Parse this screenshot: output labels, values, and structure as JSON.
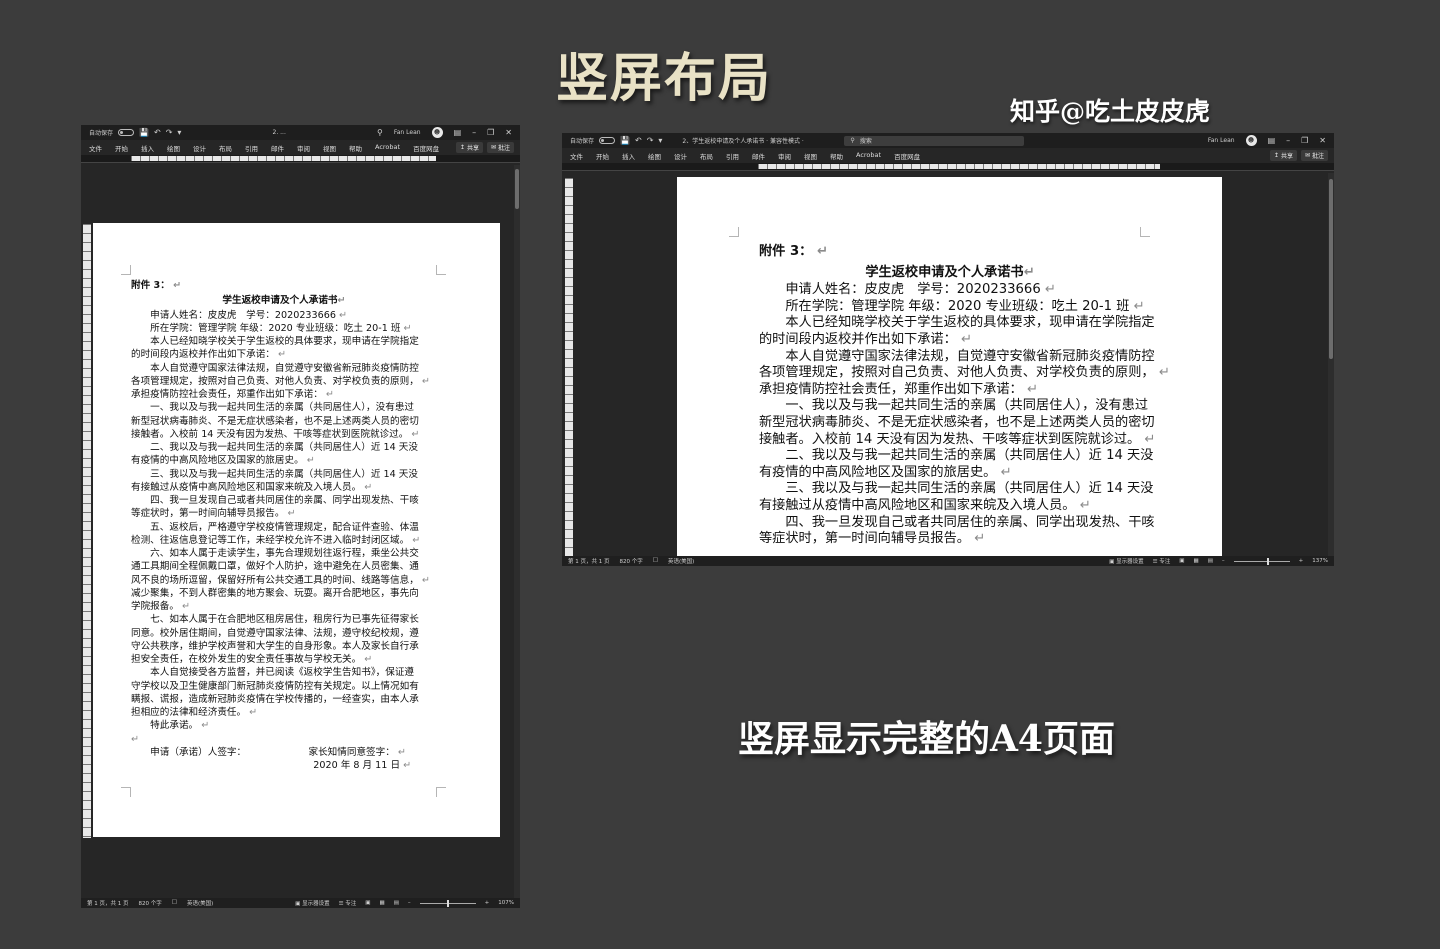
{
  "heading": "竖屏布局",
  "watermark": "知乎@吃土皮皮虎",
  "caption": "竖屏显示完整的A4页面",
  "left_window": {
    "autosave_label": "自动保存",
    "doc_title": "2. ...",
    "user_name": "Fan Lean",
    "menu": [
      "文件",
      "开始",
      "插入",
      "绘图",
      "设计",
      "布局",
      "引用",
      "邮件",
      "审阅",
      "视图",
      "帮助",
      "Acrobat",
      "百度网盘"
    ],
    "share_label": "共享",
    "comment_label": "批注",
    "status": {
      "page": "第 1 页，共 1 页",
      "words": "820 个字",
      "lang": "英语(美国)",
      "display": "显示器设置",
      "focus": "专注",
      "zoom": "107%",
      "zoom_fraction": 0.5
    }
  },
  "right_window": {
    "autosave_label": "自动保存",
    "doc_title": "2、学生返校申请及个人承诺书 · 兼容性模式 ·",
    "search_placeholder": "搜索",
    "user_name": "Fan Lean",
    "menu": [
      "文件",
      "开始",
      "插入",
      "绘图",
      "设计",
      "布局",
      "引用",
      "邮件",
      "审阅",
      "视图",
      "帮助",
      "Acrobat",
      "百度网盘"
    ],
    "share_label": "共享",
    "comment_label": "批注",
    "status": {
      "page": "第 1 页，共 1 页",
      "words": "820 个字",
      "lang": "英语(美国)",
      "display": "显示器设置",
      "focus": "专注",
      "zoom": "137%",
      "zoom_fraction": 0.62
    }
  },
  "document": {
    "attachment": "附件 3：",
    "title": "学生返校申请及个人承诺书",
    "left_lines": [
      "　　申请人姓名：皮皮虎　学号：2020233666",
      "　　所在学院：管理学院  年级：2020  专业班级：吃土 20-1 班",
      "　　本人已经知晓学校关于学生返校的具体要求，现申请在学院指定",
      "的时间段内返校并作出如下承诺：",
      "　　本人自觉遵守国家法律法规，自觉遵守安徽省新冠肺炎疫情防控",
      "各项管理规定，按照对自己负责、对他人负责、对学校负责的原则，",
      "承担疫情防控社会责任，郑重作出如下承诺：",
      "　　一、我以及与我一起共同生活的亲属（共同居住人），没有患过",
      "新型冠状病毒肺炎、不是无症状感染者，也不是上述两类人员的密切",
      "接触者。入校前 14 天没有因为发热、干咳等症状到医院就诊过。",
      "　　二、我以及与我一起共同生活的亲属（共同居住人）近 14 天没",
      "有疫情的中高风险地区及国家的旅居史。",
      "　　三、我以及与我一起共同生活的亲属（共同居住人）近 14 天没",
      "有接触过从疫情中高风险地区和国家来皖及入境人员。",
      "　　四、我一旦发现自己或者共同居住的亲属、同学出现发热、干咳",
      "等症状时，第一时间向辅导员报告。",
      "　　五、返校后，严格遵守学校疫情管理规定，配合证件查验、体温",
      "检测、往返信息登记等工作，未经学校允许不进入临时封闭区域。",
      "　　六、如本人属于走读学生，事先合理规划往返行程，乘坐公共交",
      "通工具期间全程佩戴口罩，做好个人防护，途中避免在人员密集、通",
      "风不良的场所逗留，保留好所有公共交通工具的时间、线路等信息，",
      "减少聚集，不到人群密集的地方聚会、玩耍。离开合肥地区，事先向",
      "学院报备。",
      "　　七、如本人属于在合肥地区租房居住，租房行为已事先征得家长",
      "同意。校外居住期间，自觉遵守国家法律、法规，遵守校纪校规，遵",
      "守公共秩序，维护学校声誉和大学生的自身形象。本人及家长自行承",
      "担安全责任，在校外发生的安全责任事故与学校无关。",
      "　　本人自觉接受各方监督，并已阅读《返校学生告知书》，保证遵",
      "守学校以及卫生健康部门新冠肺炎疫情防控有关规定。以上情况如有",
      "瞒报、谎报，造成新冠肺炎疫情在学校传播的，一经查实，由本人承",
      "担相应的法律和经济责任。",
      "　　特此承诺。",
      "",
      "　　申请（承诺）人签字：　　　　　　　家长知情同意签字：",
      "　　　　　　　　　　　　　　　　　　　2020 年  8 月  11 日"
    ],
    "right_lines": [
      "　　申请人姓名：皮皮虎　学号：2020233666",
      "　　所在学院：管理学院  年级：2020  专业班级：吃土 20-1 班",
      "　　本人已经知晓学校关于学生返校的具体要求，现申请在学院指定",
      "的时间段内返校并作出如下承诺：",
      "　　本人自觉遵守国家法律法规，自觉遵守安徽省新冠肺炎疫情防控",
      "各项管理规定，按照对自己负责、对他人负责、对学校负责的原则，",
      "承担疫情防控社会责任，郑重作出如下承诺：",
      "　　一、我以及与我一起共同生活的亲属（共同居住人），没有患过",
      "新型冠状病毒肺炎、不是无症状感染者，也不是上述两类人员的密切",
      "接触者。入校前 14 天没有因为发热、干咳等症状到医院就诊过。",
      "　　二、我以及与我一起共同生活的亲属（共同居住人）近 14 天没",
      "有疫情的中高风险地区及国家的旅居史。",
      "　　三、我以及与我一起共同生活的亲属（共同居住人）近 14 天没",
      "有接触过从疫情中高风险地区和国家来皖及入境人员。",
      "　　四、我一旦发现自己或者共同居住的亲属、同学出现发热、干咳",
      "等症状时，第一时间向辅导员报告。"
    ]
  }
}
